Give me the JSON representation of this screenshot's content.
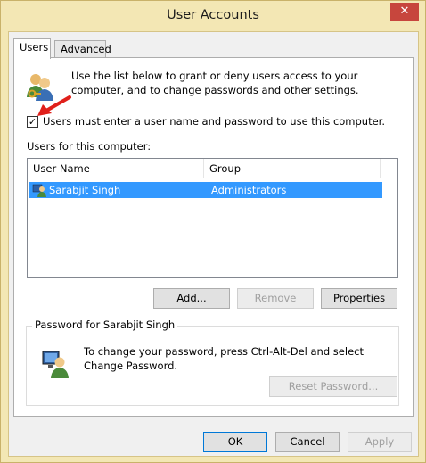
{
  "window": {
    "title": "User Accounts",
    "close_glyph": "✕"
  },
  "tabs": [
    {
      "label": "Users",
      "active": true
    },
    {
      "label": "Advanced",
      "active": false
    }
  ],
  "users_tab": {
    "intro": "Use the list below to grant or deny users access to your computer, and to change passwords and other settings.",
    "require_login": {
      "checked": true,
      "check_glyph": "✓",
      "label": "Users must enter a user name and password to use this computer."
    },
    "users_list_label": "Users for this computer:",
    "columns": [
      "User Name",
      "Group"
    ],
    "rows": [
      {
        "user_name": "Sarabjit Singh",
        "group": "Administrators",
        "selected": true
      }
    ],
    "buttons": {
      "add": "Add...",
      "remove": "Remove",
      "properties": "Properties"
    },
    "password_group": {
      "title": "Password for Sarabjit Singh",
      "text": "To change your password, press Ctrl-Alt-Del and select Change Password.",
      "reset_button": "Reset Password..."
    }
  },
  "footer": {
    "ok": "OK",
    "cancel": "Cancel",
    "apply": "Apply"
  },
  "colors": {
    "selection": "#3399ff",
    "close_button": "#c7463d",
    "annotation_arrow": "#e0201b",
    "window_frame": "#f3e7b4"
  },
  "icons": [
    "users-icon",
    "user-row-icon",
    "computer-user-icon",
    "red-arrow-annotation"
  ]
}
